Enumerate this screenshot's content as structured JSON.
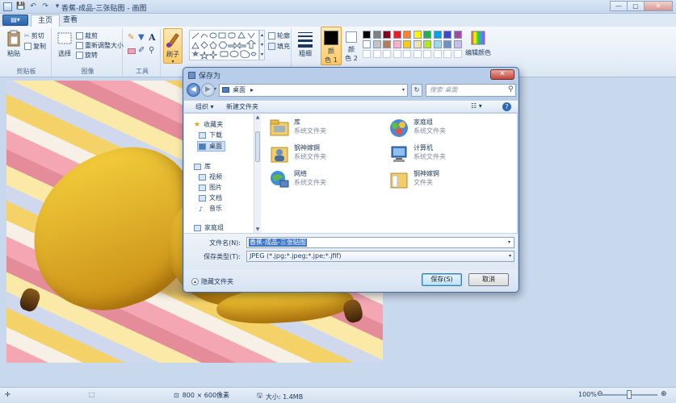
{
  "window": {
    "title": "香蕉-成品-三张贴图 - 画图",
    "controls": [
      "—",
      "▢",
      "✕"
    ]
  },
  "qat": [
    "💾",
    "↶",
    "↷",
    "▾"
  ],
  "ribbon": {
    "file_button": "▤▾",
    "tabs": [
      "主页",
      "查看"
    ],
    "groups": {
      "clipboard": {
        "label": "剪贴板",
        "paste": "粘贴",
        "cut": "剪切",
        "copy": "复制"
      },
      "image": {
        "label": "图像",
        "select": "选择",
        "crop": "裁剪",
        "resize": "重新调整大小",
        "rotate": "旋转"
      },
      "tools": {
        "label": "工具"
      },
      "brush": {
        "label": "刷子"
      },
      "shapes": {
        "label": "形状",
        "outline": "轮廓",
        "fill": "填充"
      },
      "size": {
        "label": "粗细"
      },
      "color1": {
        "label_line1": "颜",
        "label_line2": "色 1"
      },
      "color2": {
        "label_line1": "颜",
        "label_line2": "色 2"
      },
      "edit_colors": {
        "label": "编辑颜色"
      }
    },
    "palette_row1": [
      "#000000",
      "#7f7f7f",
      "#880015",
      "#ed1c24",
      "#ff7f27",
      "#fff200",
      "#22b14c",
      "#00a2e8",
      "#3f48cc",
      "#a349a4"
    ],
    "palette_row2": [
      "#ffffff",
      "#c3c3c3",
      "#b97a57",
      "#ffaec9",
      "#ffc90e",
      "#efe4b0",
      "#b5e61d",
      "#99d9ea",
      "#7092be",
      "#c8bfe7"
    ]
  },
  "dialog": {
    "title": "保存为",
    "close": "✕",
    "address": "桌面",
    "search_placeholder": "搜索 桌面",
    "toolbar": {
      "organize": "组织 ▾",
      "new_folder": "新建文件夹"
    },
    "nav": {
      "favorites": "收藏夹",
      "downloads": "下载",
      "desktop": "桌面",
      "libraries": "库",
      "videos": "视频",
      "pictures": "图片",
      "documents": "文档",
      "music": "音乐",
      "homegroup": "家庭组"
    },
    "items": [
      {
        "name": "库",
        "desc": "系统文件夹"
      },
      {
        "name": "家庭组",
        "desc": "系统文件夹"
      },
      {
        "name": "钢神嫁锕",
        "desc": "系统文件夹"
      },
      {
        "name": "计算机",
        "desc": "系统文件夹"
      },
      {
        "name": "网络",
        "desc": "系统文件夹"
      },
      {
        "name": "钢神嫁锕",
        "desc": "文件夹"
      }
    ],
    "filename_label": "文件名(N):",
    "filename_value": "香蕉-成品-三张贴图",
    "filetype_label": "保存类型(T):",
    "filetype_value": "JPEG (*.jpg;*.jpeg;*.jpe;*.jfif)",
    "hide_folders": "隐藏文件夹",
    "save": "保存(S)",
    "cancel": "取消"
  },
  "status": {
    "dimensions": "800 × 600像素",
    "filesize": "大小: 1.4MB",
    "zoom": "100%"
  }
}
